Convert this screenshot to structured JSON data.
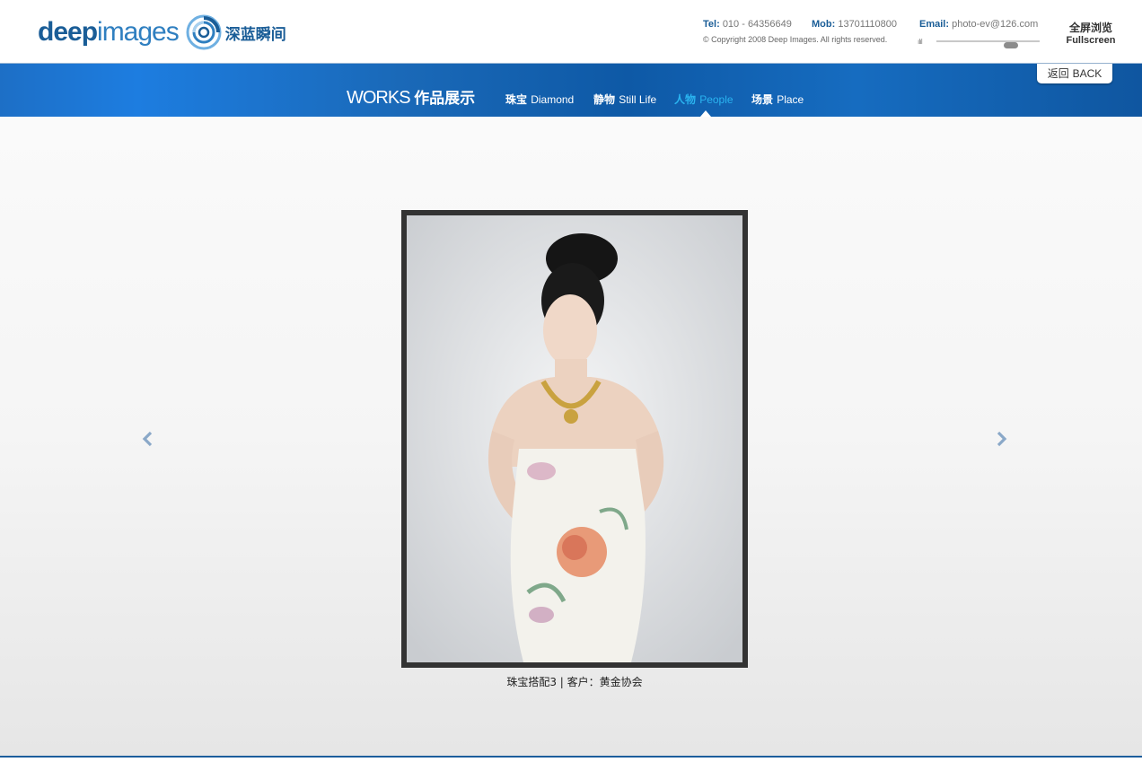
{
  "header": {
    "logo": {
      "word_bold": "deep",
      "word_light": "images",
      "chinese": "深蓝瞬间"
    },
    "contact": {
      "tel_label": "Tel:",
      "tel_value": "010 - 64356649",
      "mob_label": "Mob:",
      "mob_value": "13701110800",
      "email_label": "Email:",
      "email_value": "photo-ev@126.com"
    },
    "copyright": "© Copyright 2008 Deep Images. All rights reserved.",
    "volume": {
      "icon": "volume-bars-icon",
      "level": 0.76
    },
    "fullscreen": {
      "cn": "全屏浏览",
      "en": "Fullscreen"
    }
  },
  "nav": {
    "title_en": "WORKS",
    "title_cn": "作品展示",
    "items": [
      {
        "cn": "珠宝",
        "en": "Diamond",
        "active": false
      },
      {
        "cn": "静物",
        "en": "Still Life",
        "active": false
      },
      {
        "cn": "人物",
        "en": "People",
        "active": true
      },
      {
        "cn": "场景",
        "en": "Place",
        "active": false
      }
    ],
    "back": {
      "cn": "返回",
      "en": "BACK"
    }
  },
  "gallery": {
    "prev_icon": "chevron-left-icon",
    "next_icon": "chevron-right-icon",
    "caption": "珠宝搭配3 | 客户：黄金协会"
  },
  "colors": {
    "brand_blue": "#1a5d97",
    "nav_active": "#2ab4f0",
    "frame": "#333333"
  }
}
